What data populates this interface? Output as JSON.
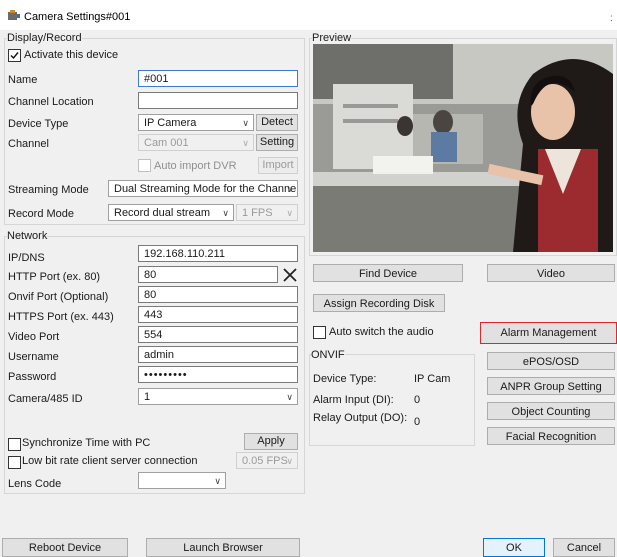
{
  "window": {
    "title": "Camera Settings#001",
    "icon": "camera-settings-app-icon"
  },
  "display_record": {
    "group_label": "Display/Record",
    "activate_label": "Activate this device",
    "activate_checked": true,
    "name_label": "Name",
    "name_value": "#001",
    "channel_location_label": "Channel Location",
    "channel_location_value": "",
    "device_type_label": "Device Type",
    "device_type_value": "IP Camera",
    "detect_label": "Detect",
    "channel_label": "Channel",
    "channel_value": "Cam 001",
    "setting_label": "Setting",
    "auto_import_label": "Auto import DVR",
    "import_label": "Import",
    "streaming_mode_label": "Streaming Mode",
    "streaming_mode_value": "Dual Streaming Mode for the Channel",
    "record_mode_label": "Record Mode",
    "record_mode_value": "Record dual stream",
    "fps_value": "1 FPS"
  },
  "network": {
    "group_label": "Network",
    "ip_label": "IP/DNS",
    "ip_value": "192.168.110.211",
    "http_label": "HTTP Port (ex. 80)",
    "http_value": "80",
    "onvif_label": "Onvif Port (Optional)",
    "onvif_value": "80",
    "https_label": "HTTPS Port (ex. 443)",
    "https_value": "443",
    "video_port_label": "Video Port",
    "video_port_value": "554",
    "username_label": "Username",
    "username_value": "admin",
    "password_label": "Password",
    "password_value": "•••••••••",
    "camera485_label": "Camera/485 ID",
    "camera485_value": "1",
    "sync_time_label": "Synchronize Time with PC",
    "apply_label": "Apply",
    "low_bitrate_label": "Low bit rate client  server connection",
    "low_bitrate_fps": "0.05 FPS",
    "lens_code_label": "Lens Code",
    "lens_code_value": ""
  },
  "preview": {
    "group_label": "Preview",
    "find_device_label": "Find Device",
    "video_label": "Video",
    "assign_disk_label": "Assign Recording Disk",
    "auto_switch_audio_label": "Auto switch the audio",
    "alarm_management_label": "Alarm Management",
    "epos_label": "ePOS/OSD",
    "anpr_label": "ANPR Group Setting",
    "object_counting_label": "Object Counting",
    "facial_recognition_label": "Facial Recognition"
  },
  "onvif": {
    "group_label": "ONVIF",
    "device_type_label": "Device Type:",
    "device_type_value": "IP Cam",
    "alarm_input_label": "Alarm Input (DI):",
    "alarm_input_value": "0",
    "relay_output_label": "Relay Output (DO):",
    "relay_output_value": "0"
  },
  "footer": {
    "reboot_label": "Reboot Device",
    "launch_browser_label": "Launch Browser",
    "ok_label": "OK",
    "cancel_label": "Cancel"
  },
  "colors": {
    "accent": "#0078d7",
    "highlight": "#e0252b",
    "window_bg": "#f0f0f0"
  }
}
